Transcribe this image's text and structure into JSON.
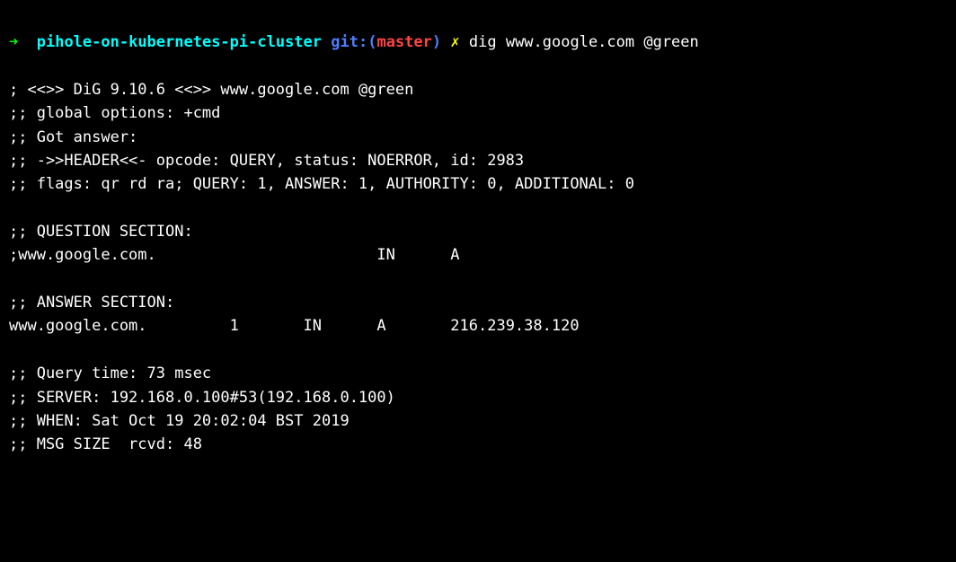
{
  "prompt": {
    "arrow": "➜",
    "directory": "pihole-on-kubernetes-pi-cluster",
    "git_label": "git:",
    "git_paren_open": "(",
    "git_branch": "master",
    "git_paren_close": ")",
    "dirty_marker": "✗",
    "command": "dig www.google.com @green"
  },
  "output": {
    "line1": "",
    "line2": "; <<>> DiG 9.10.6 <<>> www.google.com @green",
    "line3": ";; global options: +cmd",
    "line4": ";; Got answer:",
    "line5": ";; ->>HEADER<<- opcode: QUERY, status: NOERROR, id: 2983",
    "line6": ";; flags: qr rd ra; QUERY: 1, ANSWER: 1, AUTHORITY: 0, ADDITIONAL: 0",
    "line7": "",
    "line8": ";; QUESTION SECTION:",
    "line9": ";www.google.com.\t\t\tIN\tA",
    "line10": "",
    "line11": ";; ANSWER SECTION:",
    "line12": "www.google.com.\t\t1\tIN\tA\t216.239.38.120",
    "line13": "",
    "line14": ";; Query time: 73 msec",
    "line15": ";; SERVER: 192.168.0.100#53(192.168.0.100)",
    "line16": ";; WHEN: Sat Oct 19 20:02:04 BST 2019",
    "line17": ";; MSG SIZE  rcvd: 48"
  }
}
